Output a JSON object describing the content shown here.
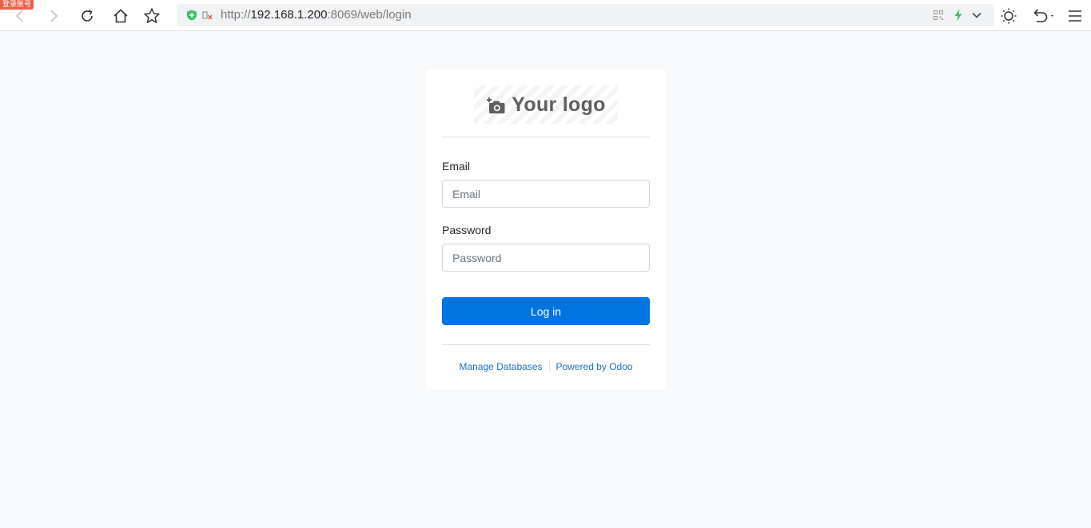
{
  "browser": {
    "extension_badge": "登录账号",
    "address": {
      "scheme": "http://",
      "host": "192.168.1.200",
      "rest": ":8069/web/login"
    },
    "icons": {
      "back": "back-arrow-icon",
      "forward": "forward-arrow-icon",
      "reload": "reload-icon",
      "home": "home-icon",
      "bookmark": "star-icon",
      "security": "shield-icon",
      "cookie": "cookie-blocked-icon",
      "qr": "qr-code-icon",
      "speed": "lightning-icon",
      "dropdown": "chevron-down-icon",
      "theme": "sun-icon",
      "undo": "undo-icon",
      "menu": "hamburger-menu-icon"
    },
    "accent_green": "#3cc06b"
  },
  "login": {
    "logo_text": "Your logo",
    "email_label": "Email",
    "email_placeholder": "Email",
    "email_value": "",
    "password_label": "Password",
    "password_placeholder": "Password",
    "password_value": "",
    "submit_label": "Log in",
    "submit_color": "#0075e2",
    "links": {
      "manage_db": "Manage Databases",
      "powered_by": "Powered by Odoo"
    }
  }
}
